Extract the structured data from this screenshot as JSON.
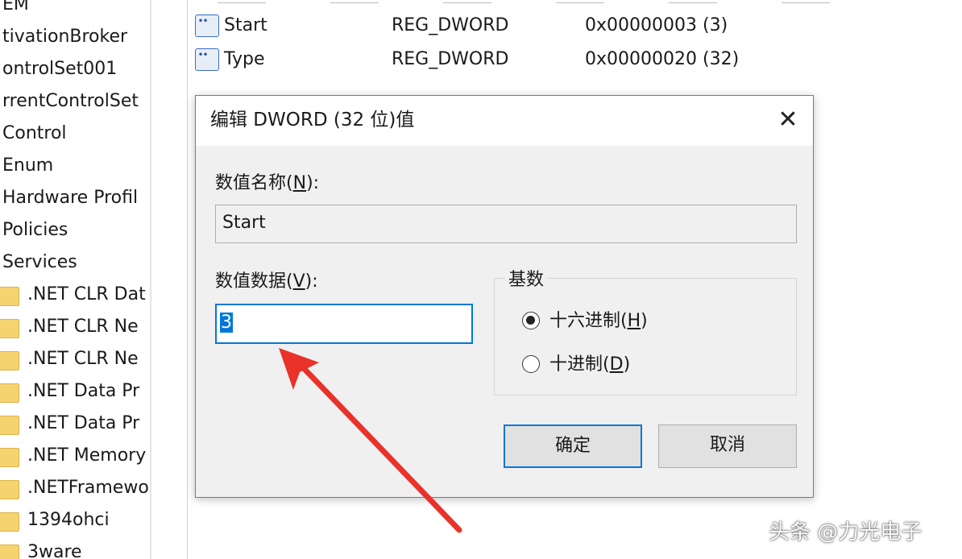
{
  "tree": {
    "items": [
      {
        "label": "EM",
        "folder": false
      },
      {
        "label": "tivationBroker",
        "folder": false
      },
      {
        "label": "ontrolSet001",
        "folder": false
      },
      {
        "label": "rrentControlSet",
        "folder": false
      },
      {
        "label": "Control",
        "folder": false
      },
      {
        "label": "Enum",
        "folder": false
      },
      {
        "label": "Hardware Profil",
        "folder": false
      },
      {
        "label": "Policies",
        "folder": false
      },
      {
        "label": "Services",
        "folder": false
      },
      {
        "label": ".NET CLR Dat",
        "folder": true
      },
      {
        "label": ".NET CLR Ne",
        "folder": true
      },
      {
        "label": ".NET CLR Ne",
        "folder": true
      },
      {
        "label": ".NET Data Pr",
        "folder": true
      },
      {
        "label": ".NET Data Pr",
        "folder": true
      },
      {
        "label": ".NET Memory",
        "folder": true
      },
      {
        "label": ".NETFramewo",
        "folder": true
      },
      {
        "label": "1394ohci",
        "folder": true
      },
      {
        "label": "3ware",
        "folder": true
      }
    ]
  },
  "values": [
    {
      "name": "Start",
      "type": "REG_DWORD",
      "data": "0x00000003 (3)",
      "icon": "reg-dword-icon"
    },
    {
      "name": "Type",
      "type": "REG_DWORD",
      "data": "0x00000020 (32)",
      "icon": "reg-dword-icon"
    }
  ],
  "dialog": {
    "title": "编辑 DWORD (32 位)值",
    "close_glyph": "✕",
    "value_name_label": "数值名称",
    "value_name_key": "N",
    "value_name": "Start",
    "value_data_label": "数值数据",
    "value_data_key": "V",
    "value_data": "3",
    "base_label": "基数",
    "hex_label": "十六进制",
    "hex_key": "H",
    "dec_label": "十进制",
    "dec_key": "D",
    "base_selected": "hex",
    "ok_label": "确定",
    "cancel_label": "取消"
  },
  "annotation": {
    "color": "#e8322a"
  },
  "watermark": "头条 @力光电子"
}
